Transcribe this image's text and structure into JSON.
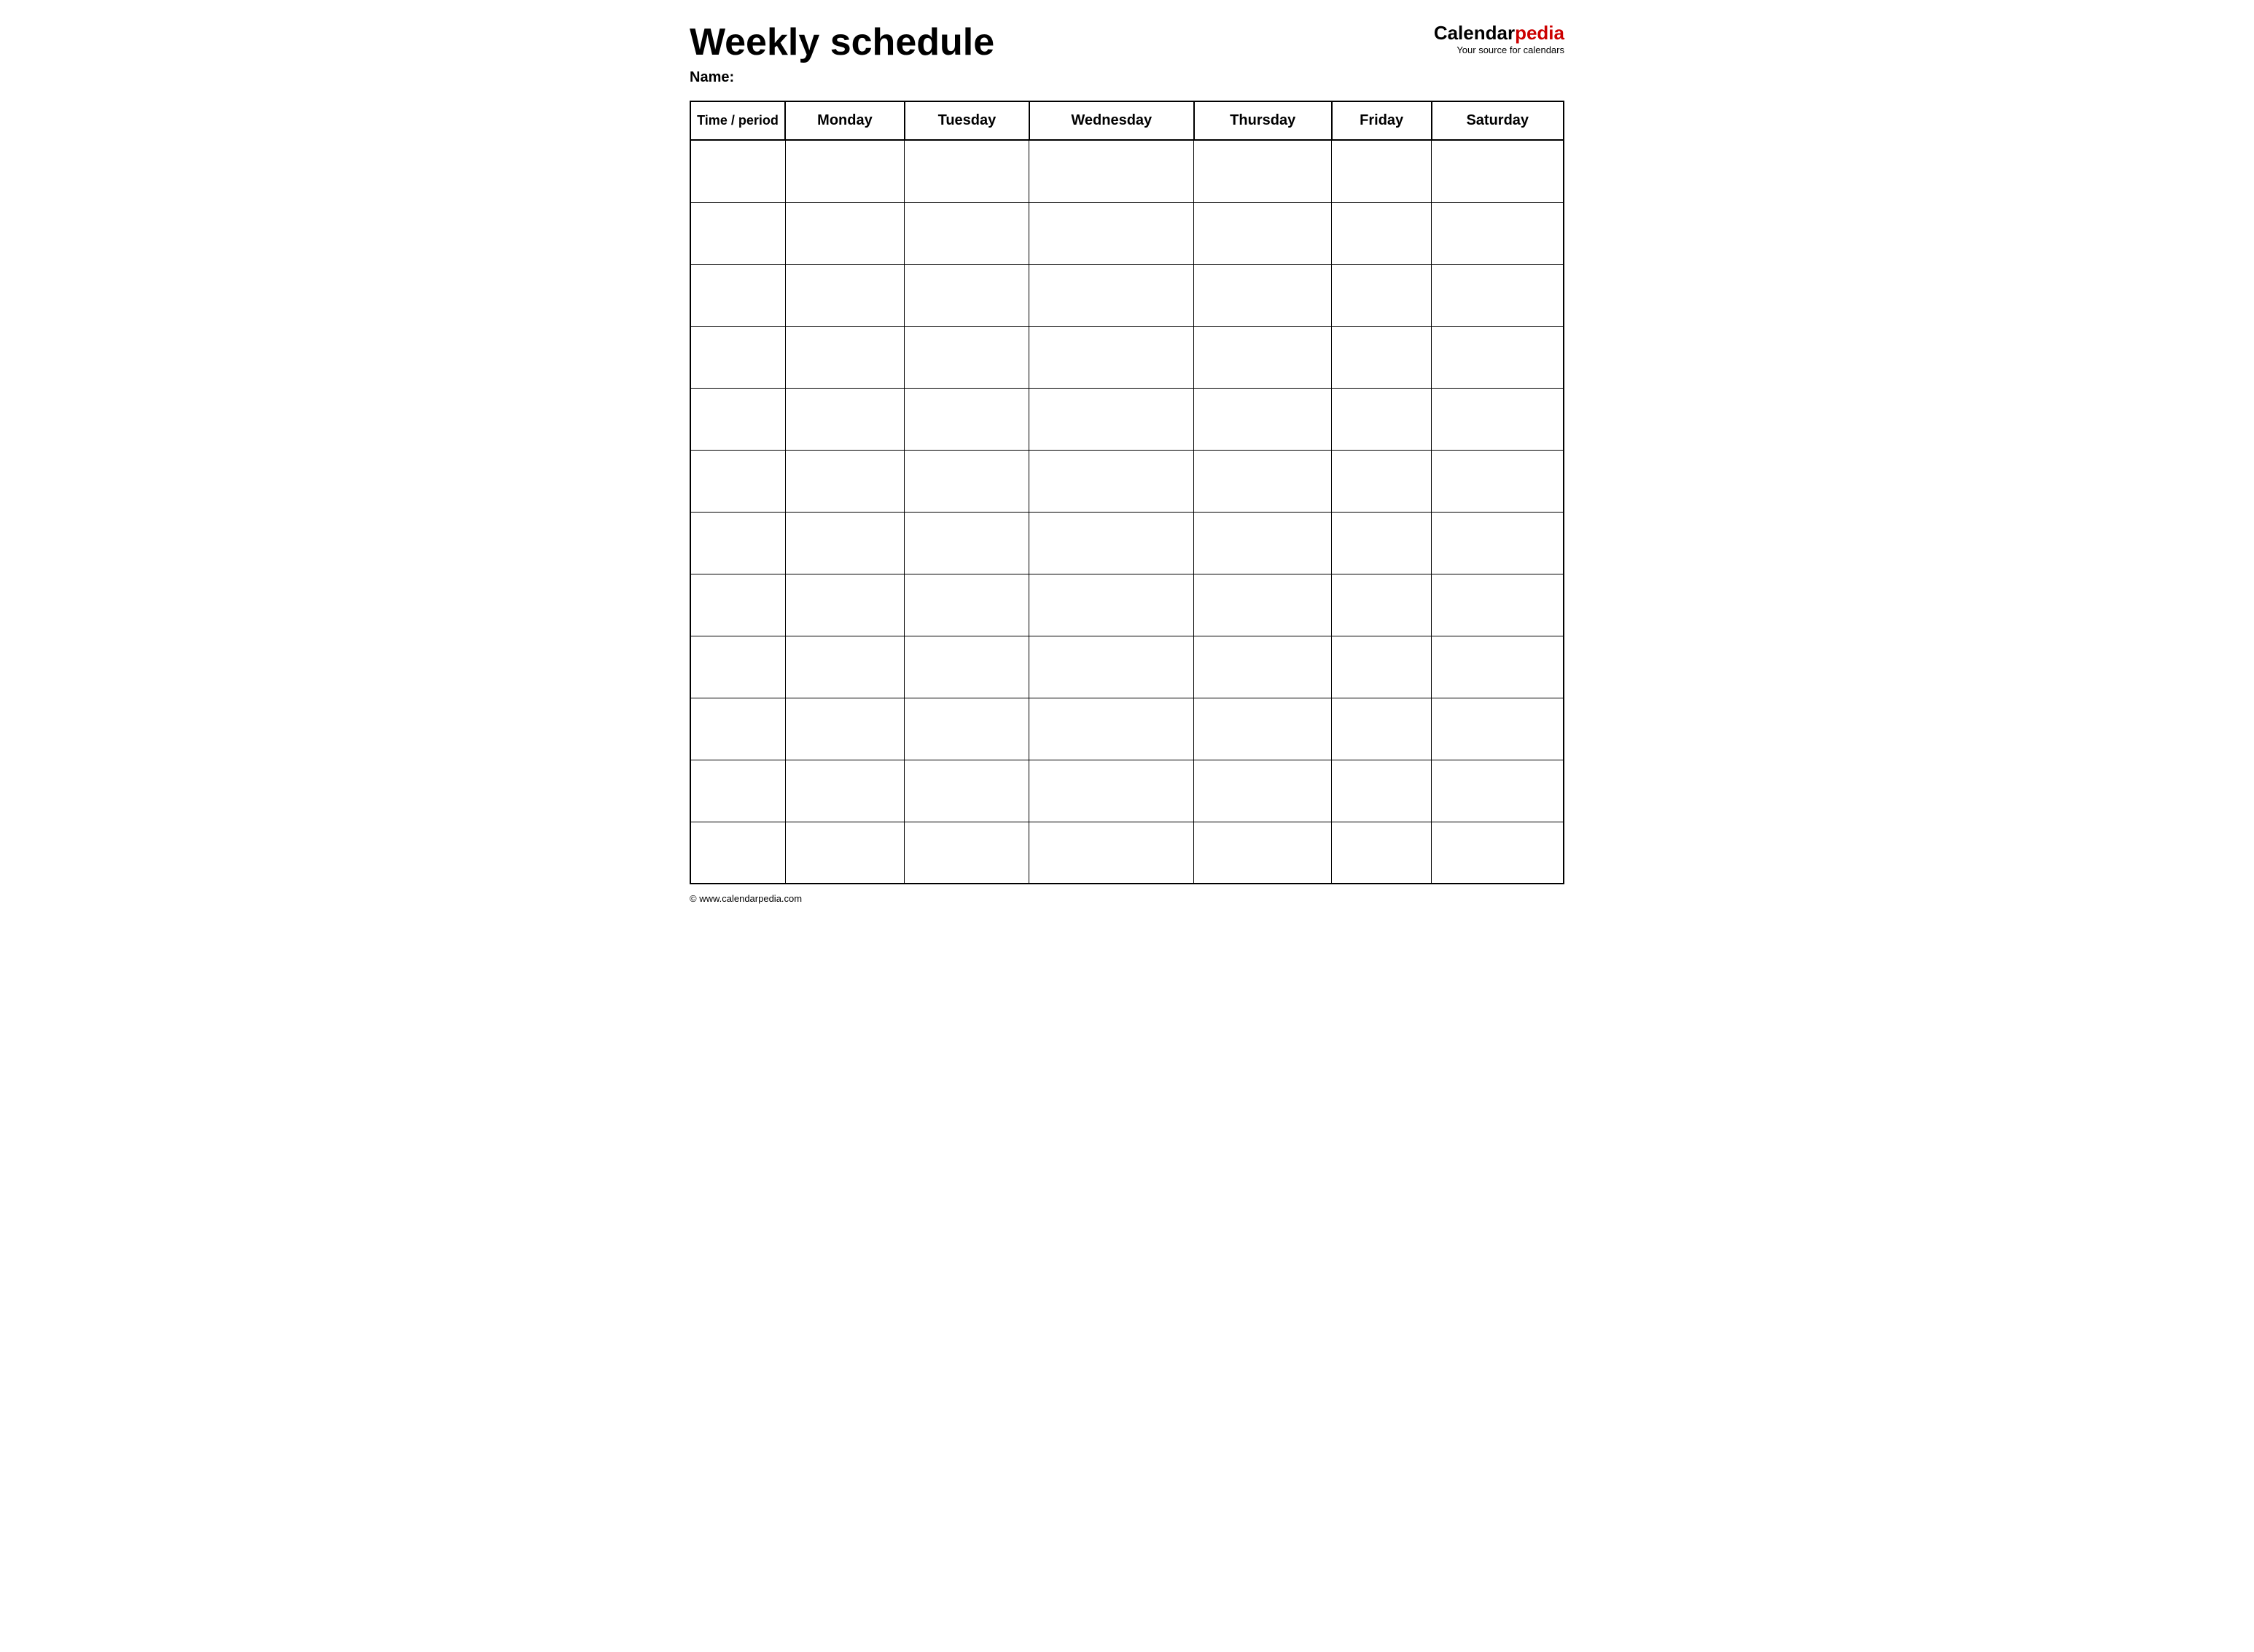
{
  "header": {
    "title": "Weekly schedule",
    "name_label": "Name:",
    "logo": {
      "calendar_part": "Calendar",
      "pedia_part": "pedia",
      "tagline": "Your source for calendars"
    }
  },
  "table": {
    "columns": [
      "Time / period",
      "Monday",
      "Tuesday",
      "Wednesday",
      "Thursday",
      "Friday",
      "Saturday"
    ],
    "row_count": 12
  },
  "footer": {
    "text": "© www.calendarpedia.com"
  }
}
